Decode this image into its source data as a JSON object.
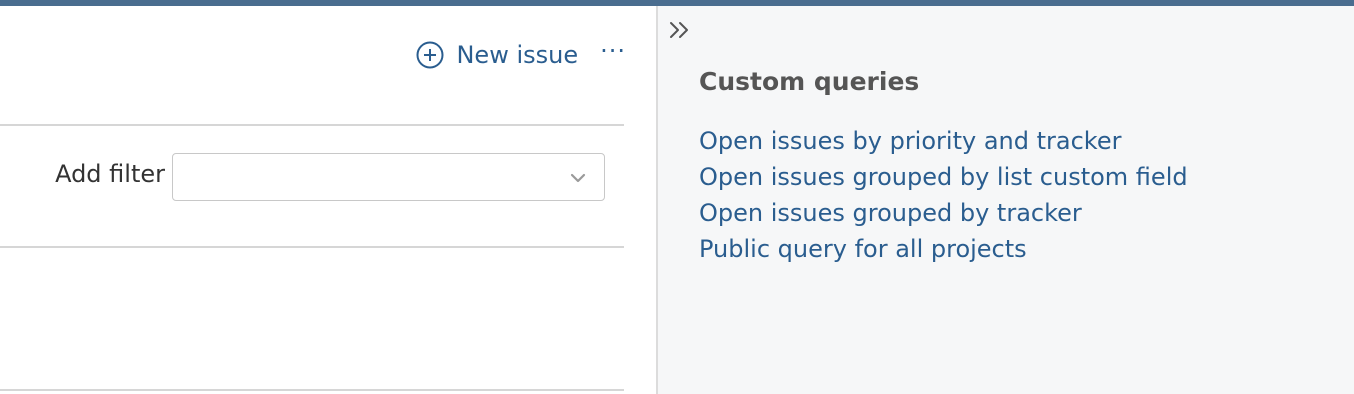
{
  "header": {
    "new_issue_label": "New issue",
    "more_label": "···"
  },
  "filters": {
    "add_filter_label": "Add filter",
    "selected_value": ""
  },
  "sidebar": {
    "title": "Custom queries",
    "queries": [
      "Open issues by priority and tracker",
      "Open issues grouped by list custom field",
      "Open issues grouped by tracker",
      "Public query for all projects"
    ]
  },
  "colors": {
    "link": "#2a5d8f",
    "top_bar": "#4a6d8f",
    "sidebar_bg": "#f6f7f8"
  },
  "icons": [
    "plus-circle-icon",
    "more-icon",
    "chevron-down-icon",
    "double-chevron-right-icon"
  ]
}
